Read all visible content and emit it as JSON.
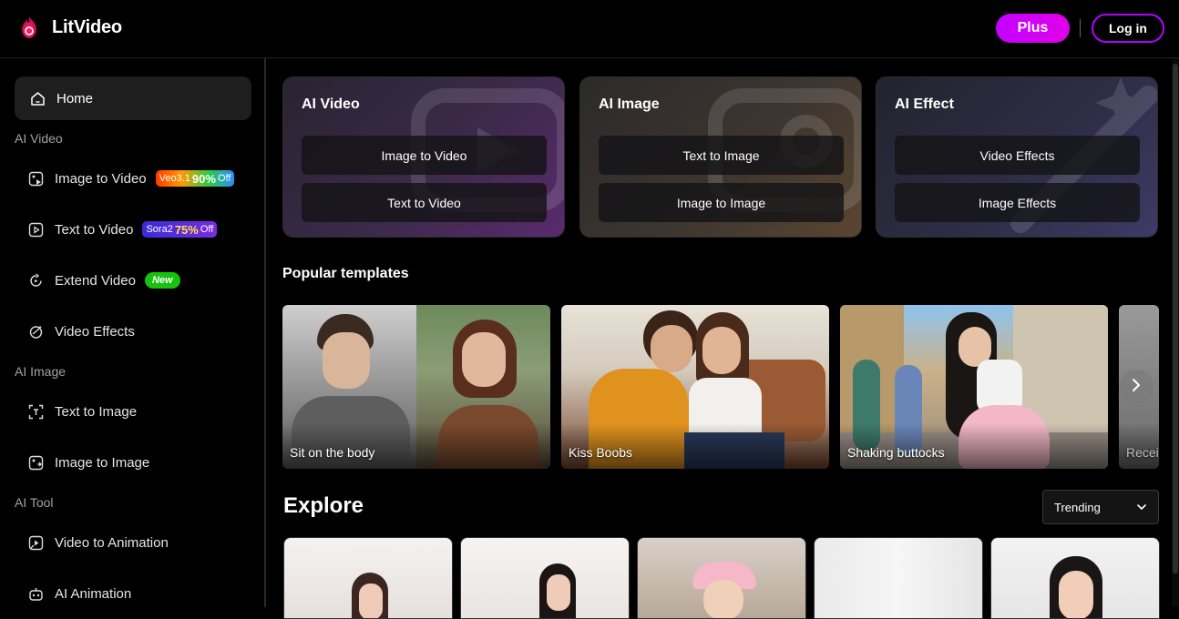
{
  "header": {
    "app_name": "LitVideo",
    "plus_label": "Plus",
    "login_label": "Log in"
  },
  "sidebar": {
    "home": "Home",
    "sections": [
      {
        "title": "AI Video",
        "items": [
          {
            "label": "Image to Video",
            "badge": {
              "prefix": "Veo3.1",
              "value": "90%",
              "suffix": "Off"
            }
          },
          {
            "label": "Text to Video",
            "badge": {
              "prefix": "Sora2",
              "value": "75%",
              "suffix": "Off"
            }
          },
          {
            "label": "Extend Video",
            "badge": {
              "text": "New"
            }
          },
          {
            "label": "Video Effects"
          }
        ]
      },
      {
        "title": "AI Image",
        "items": [
          {
            "label": "Text to Image"
          },
          {
            "label": "Image to Image"
          }
        ]
      },
      {
        "title": "AI Tool",
        "items": [
          {
            "label": "Video to Animation"
          },
          {
            "label": "AI Animation"
          }
        ]
      }
    ]
  },
  "cards": [
    {
      "title": "AI Video",
      "buttons": [
        "Image to Video",
        "Text to Video"
      ]
    },
    {
      "title": "AI Image",
      "buttons": [
        "Text to Image",
        "Image to Image"
      ]
    },
    {
      "title": "AI Effect",
      "buttons": [
        "Video Effects",
        "Image Effects"
      ]
    }
  ],
  "popular": {
    "title": "Popular templates",
    "templates": [
      "Sit on the body",
      "Kiss Boobs",
      "Shaking buttocks",
      "Recei"
    ]
  },
  "explore": {
    "title": "Explore",
    "sort_value": "Trending"
  },
  "colors": {
    "accent": "#c400ff",
    "new_badge": "#16c20e"
  }
}
